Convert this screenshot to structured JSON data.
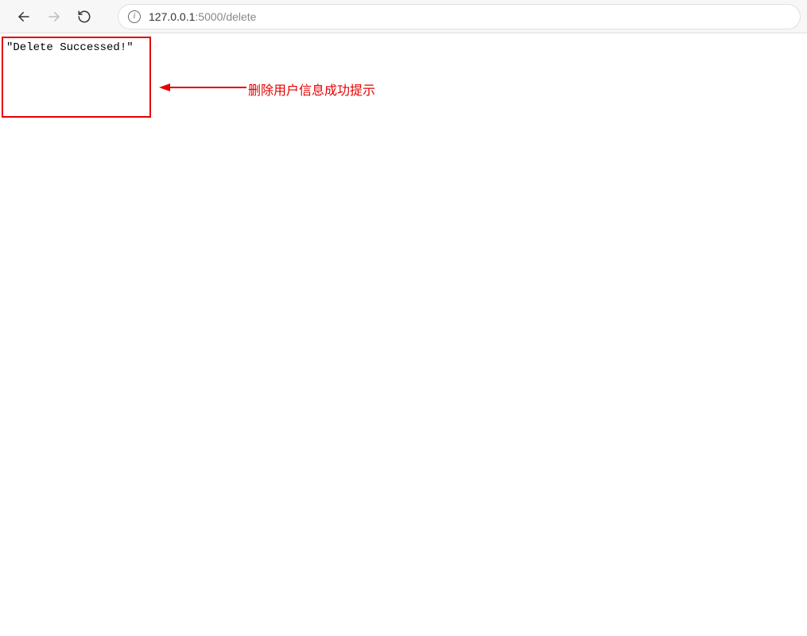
{
  "browser": {
    "url_host": "127.0.0.1",
    "url_path": ":5000/delete"
  },
  "page": {
    "message": "\"Delete Successed!\""
  },
  "annotation": {
    "label": "删除用户信息成功提示"
  }
}
